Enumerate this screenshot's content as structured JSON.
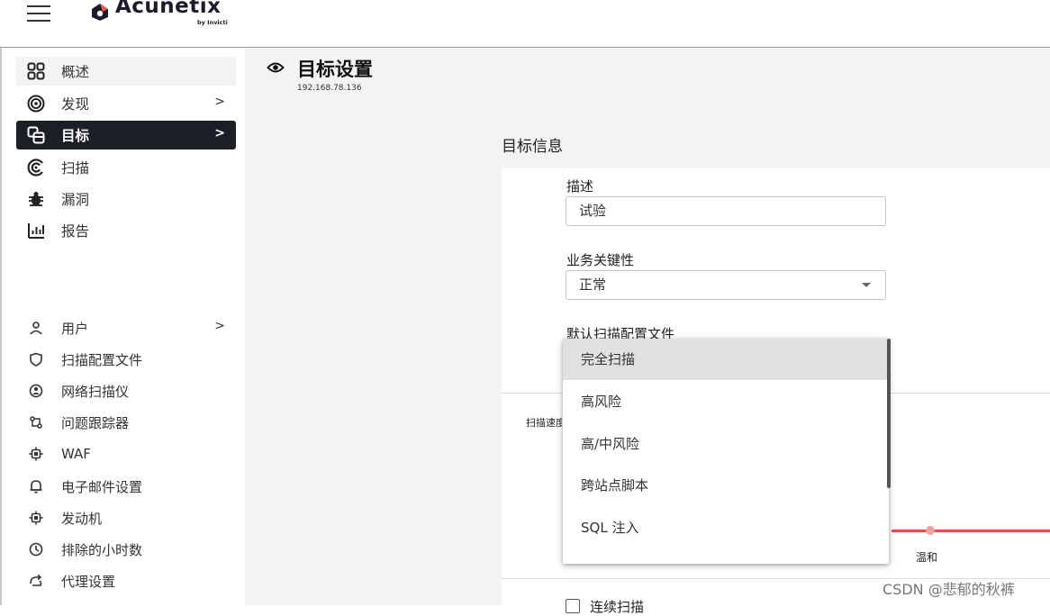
{
  "header": {
    "logo_text": "Acunetix",
    "logo_sub": "by Invicti"
  },
  "sidebar": {
    "main_items": [
      {
        "label": "概述",
        "icon": "dashboard-icon"
      },
      {
        "label": "发现",
        "icon": "discovery-icon",
        "arrow": ">"
      },
      {
        "label": "目标",
        "icon": "targets-icon",
        "arrow": ">",
        "active": true
      },
      {
        "label": "扫描",
        "icon": "scan-icon"
      },
      {
        "label": "漏洞",
        "icon": "bug-icon"
      },
      {
        "label": "报告",
        "icon": "report-icon"
      }
    ],
    "settings_items": [
      {
        "label": "用户",
        "icon": "user-icon",
        "arrow": ">"
      },
      {
        "label": "扫描配置文件",
        "icon": "shield-icon"
      },
      {
        "label": "网络扫描仪",
        "icon": "network-scanner-icon"
      },
      {
        "label": "问题跟踪器",
        "icon": "issue-tracker-icon"
      },
      {
        "label": "WAF",
        "icon": "chip-icon"
      },
      {
        "label": "电子邮件设置",
        "icon": "bell-icon"
      },
      {
        "label": "发动机",
        "icon": "engine-icon"
      },
      {
        "label": "排除的小时数",
        "icon": "clock-icon"
      },
      {
        "label": "代理设置",
        "icon": "proxy-icon"
      }
    ]
  },
  "page": {
    "title": "目标设置",
    "subtitle": "192.168.78.136"
  },
  "target_info": {
    "section_title": "目标信息",
    "description_label": "描述",
    "description_value": "试验",
    "criticality_label": "业务关键性",
    "criticality_value": "正常",
    "profile_label": "默认扫描配置文件",
    "scan_speed_label": "扫描速度",
    "slider_label": "温和",
    "continuous_scan_label": "连续扫描"
  },
  "dropdown": {
    "options": [
      "完全扫描",
      "高风险",
      "高/中风险",
      "跨站点脚本",
      "SQL 注入"
    ],
    "selected": "完全扫描"
  },
  "watermark": "CSDN @悲郁的秋裤",
  "colors": {
    "active_nav_bg": "#1d1f26",
    "slider_track": "#e05252",
    "logo_accent": "#e2574c"
  }
}
